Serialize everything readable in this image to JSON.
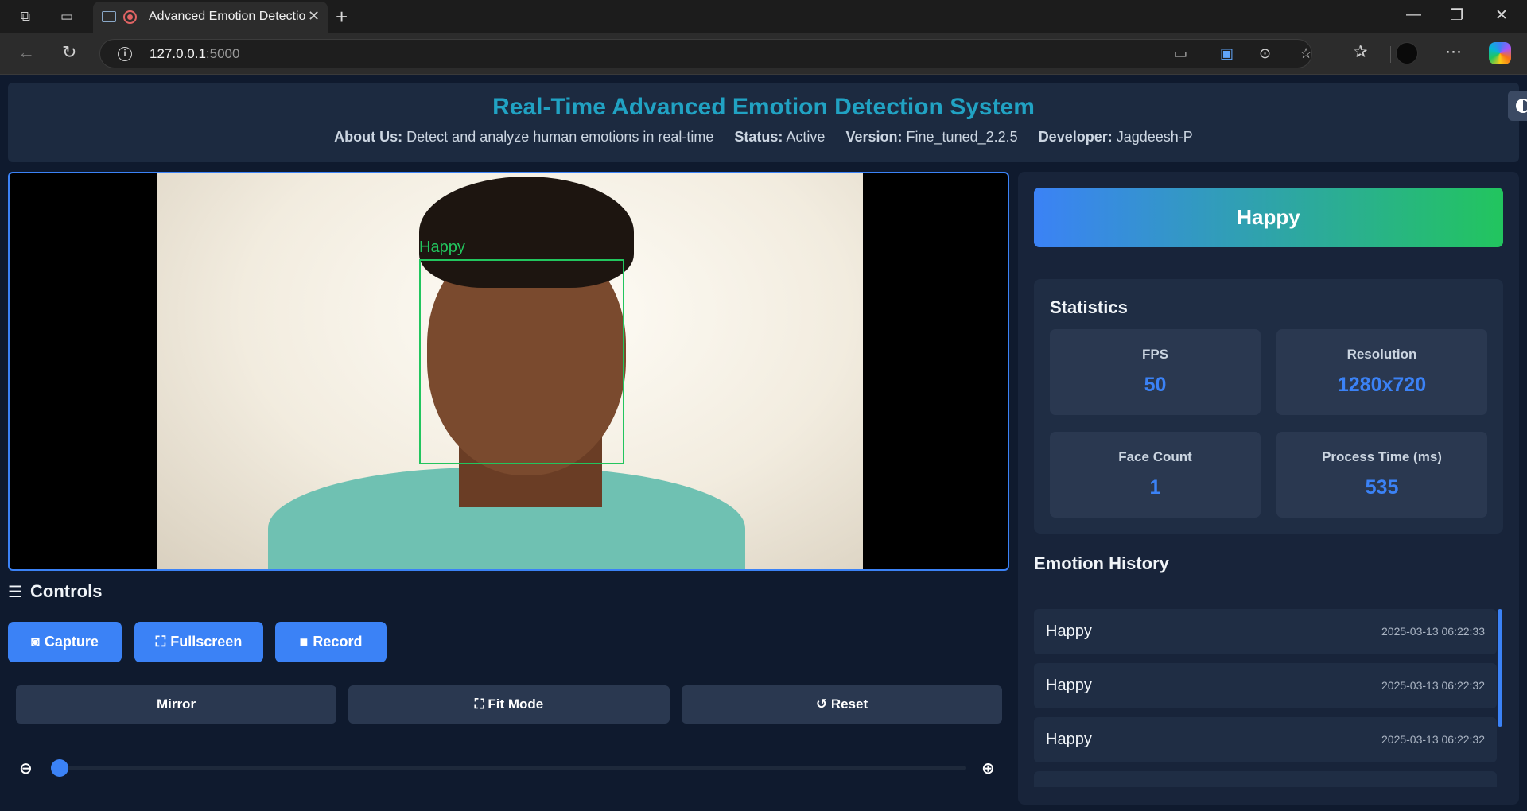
{
  "browser": {
    "tab_title": "Advanced Emotion Detection",
    "url_host": "127.0.0.1",
    "url_port": ":5000"
  },
  "header": {
    "title": "Real-Time Advanced Emotion Detection System",
    "about_label": "About Us:",
    "about_value": "Detect and analyze human emotions in real-time",
    "status_label": "Status:",
    "status_value": "Active",
    "version_label": "Version:",
    "version_value": "Fine_tuned_2.2.5",
    "developer_label": "Developer:",
    "developer_value": "Jagdeesh-P"
  },
  "video": {
    "face_label": "Happy"
  },
  "controls": {
    "title": "Controls",
    "capture_label": "Capture",
    "fullscreen_label": "Fullscreen",
    "record_label": "Record",
    "mirror_label": "Mirror",
    "fit_mode_label": "Fit Mode",
    "reset_label": "Reset",
    "zoom_level": 0
  },
  "current_emotion": "Happy",
  "statistics": {
    "title": "Statistics",
    "items": [
      {
        "label": "FPS",
        "value": "50"
      },
      {
        "label": "Resolution",
        "value": "1280x720"
      },
      {
        "label": "Face Count",
        "value": "1"
      },
      {
        "label": "Process Time (ms)",
        "value": "535"
      }
    ]
  },
  "history": {
    "title": "Emotion History",
    "items": [
      {
        "emotion": "Happy",
        "time": "2025-03-13 06:22:33"
      },
      {
        "emotion": "Happy",
        "time": "2025-03-13 06:22:32"
      },
      {
        "emotion": "Happy",
        "time": "2025-03-13 06:22:32"
      },
      {
        "emotion": "",
        "time": ""
      }
    ]
  },
  "colors": {
    "accent": "#3b82f6",
    "success": "#22c55e",
    "title": "#21a2c3",
    "background": "#0f1a2e"
  }
}
